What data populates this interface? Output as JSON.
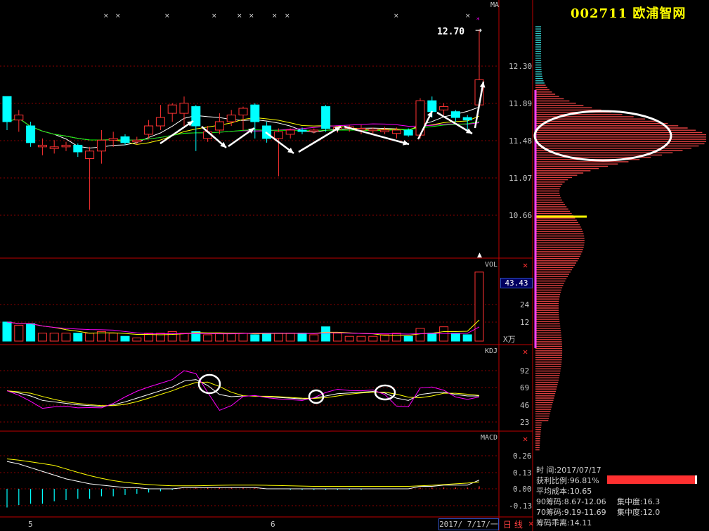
{
  "header": {
    "stock_title": "002711 欧浦智网",
    "ma_label": "MA",
    "high_label": "12.70"
  },
  "price_axis": [
    "12.30",
    "11.89",
    "11.48",
    "11.07",
    "10.66"
  ],
  "volume_panel": {
    "label": "VOL",
    "current": "43.43",
    "ticks": [
      "24",
      "12"
    ],
    "unit": "X万"
  },
  "kdj_panel": {
    "label": "KDJ",
    "ticks": [
      "92",
      "69",
      "46",
      "23"
    ]
  },
  "macd_panel": {
    "label": "MACD",
    "ticks": [
      "0.26",
      "0.13",
      "0.00",
      "-0.13"
    ]
  },
  "x_axis": [
    "5",
    "6"
  ],
  "footer": {
    "date": "2017/ 7/17/一",
    "period_tab": "日 线"
  },
  "chip_info": {
    "time": "时    间:2017/07/17",
    "profit_ratio": "获利比例:96.81%",
    "avg_cost": "平均成本:10.65",
    "chip90": "90筹码:8.67-12.06",
    "conc90": "集中度:16.3",
    "chip70": "70筹码:9.19-11.69",
    "conc70": "集中度:12.0",
    "chip_divergence": "筹码乖离:14.11"
  },
  "colors": {
    "up": "#ff3232",
    "down": "#00ffff",
    "grid": "#8a0000",
    "panel_border": "#c00000",
    "chip_red": "#e04040",
    "chip_cyan": "#30c8c8",
    "avg_cost_line": "#ffff00"
  },
  "chart_data": {
    "type": "candlestick",
    "note": "price window 10.2-12.9; last candle closes near 12.12",
    "candles": [
      {
        "o": 11.9,
        "c": 11.6,
        "h": 11.9,
        "l": 11.5
      },
      {
        "o": 11.62,
        "c": 11.68,
        "h": 11.74,
        "l": 11.48
      },
      {
        "o": 11.55,
        "c": 11.35,
        "h": 11.6,
        "l": 11.3
      },
      {
        "o": 11.3,
        "c": 11.32,
        "h": 11.4,
        "l": 11.2
      },
      {
        "o": 11.28,
        "c": 11.3,
        "h": 11.38,
        "l": 11.22
      },
      {
        "o": 11.3,
        "c": 11.32,
        "h": 11.36,
        "l": 11.25
      },
      {
        "o": 11.32,
        "c": 11.24,
        "h": 11.34,
        "l": 11.18
      },
      {
        "o": 11.16,
        "c": 11.25,
        "h": 11.3,
        "l": 10.55
      },
      {
        "o": 11.25,
        "c": 11.38,
        "h": 11.5,
        "l": 11.1
      },
      {
        "o": 11.38,
        "c": 11.4,
        "h": 11.48,
        "l": 11.3
      },
      {
        "o": 11.42,
        "c": 11.35,
        "h": 11.45,
        "l": 11.32
      },
      {
        "o": 11.36,
        "c": 11.38,
        "h": 11.42,
        "l": 11.33
      },
      {
        "o": 11.45,
        "c": 11.55,
        "h": 11.62,
        "l": 11.4
      },
      {
        "o": 11.55,
        "c": 11.65,
        "h": 11.8,
        "l": 11.5
      },
      {
        "o": 11.7,
        "c": 11.8,
        "h": 11.82,
        "l": 11.6
      },
      {
        "o": 11.7,
        "c": 11.82,
        "h": 11.9,
        "l": 11.55
      },
      {
        "o": 11.78,
        "c": 11.55,
        "h": 11.8,
        "l": 11.25
      },
      {
        "o": 11.4,
        "c": 11.48,
        "h": 11.55,
        "l": 11.36
      },
      {
        "o": 11.5,
        "c": 11.6,
        "h": 11.7,
        "l": 11.45
      },
      {
        "o": 11.6,
        "c": 11.68,
        "h": 11.74,
        "l": 11.55
      },
      {
        "o": 11.68,
        "c": 11.76,
        "h": 11.78,
        "l": 11.5
      },
      {
        "o": 11.8,
        "c": 11.6,
        "h": 11.82,
        "l": 11.4
      },
      {
        "o": 11.55,
        "c": 11.4,
        "h": 11.6,
        "l": 11.35
      },
      {
        "o": 11.4,
        "c": 11.48,
        "h": 11.52,
        "l": 10.95
      },
      {
        "o": 11.45,
        "c": 11.5,
        "h": 11.52,
        "l": 11.4
      },
      {
        "o": 11.5,
        "c": 11.49,
        "h": 11.53,
        "l": 11.45
      },
      {
        "o": 11.49,
        "c": 11.5,
        "h": 11.52,
        "l": 11.46
      },
      {
        "o": 11.78,
        "c": 11.52,
        "h": 11.8,
        "l": 11.48
      },
      {
        "o": 11.52,
        "c": 11.53,
        "h": 11.55,
        "l": 11.47
      },
      {
        "o": 11.52,
        "c": 11.54,
        "h": 11.56,
        "l": 11.48
      },
      {
        "o": 11.5,
        "c": 11.52,
        "h": 11.56,
        "l": 11.45
      },
      {
        "o": 11.5,
        "c": 11.51,
        "h": 11.53,
        "l": 11.46
      },
      {
        "o": 11.48,
        "c": 11.5,
        "h": 11.54,
        "l": 11.45
      },
      {
        "o": 11.46,
        "c": 11.5,
        "h": 11.53,
        "l": 11.4
      },
      {
        "o": 11.5,
        "c": 11.44,
        "h": 11.52,
        "l": 11.42
      },
      {
        "o": 11.44,
        "c": 11.85,
        "h": 11.88,
        "l": 11.4
      },
      {
        "o": 11.85,
        "c": 11.72,
        "h": 11.9,
        "l": 11.65
      },
      {
        "o": 11.74,
        "c": 11.78,
        "h": 11.82,
        "l": 11.68
      },
      {
        "o": 11.72,
        "c": 11.65,
        "h": 11.74,
        "l": 11.6
      },
      {
        "o": 11.65,
        "c": 11.62,
        "h": 11.68,
        "l": 11.5
      },
      {
        "o": 11.8,
        "c": 12.1,
        "h": 12.7,
        "l": 11.8
      }
    ],
    "volumes": [
      12,
      10,
      11,
      5,
      5,
      5,
      5,
      5,
      6,
      5,
      3,
      2,
      5,
      5,
      6,
      5,
      6,
      4,
      5,
      5,
      5,
      4,
      5,
      5,
      5,
      5,
      4,
      9,
      5,
      3,
      3,
      3,
      4,
      5,
      3,
      8,
      5,
      9,
      5,
      4,
      43.43
    ],
    "macd_hist": [
      -0.15,
      -0.13,
      -0.12,
      -0.12,
      -0.1,
      -0.09,
      -0.08,
      -0.08,
      -0.06,
      -0.06,
      -0.05,
      -0.04,
      -0.03,
      -0.02,
      -0.01,
      0.0,
      0.01,
      0.01,
      0.01,
      0.01,
      0.01,
      0.01,
      0.0,
      0.0,
      -0.01,
      -0.01,
      -0.01,
      -0.01,
      -0.01,
      -0.01,
      -0.01,
      0.0,
      0.0,
      0.0,
      0.0,
      0.01,
      0.01,
      0.01,
      0.01,
      0.01,
      0.02
    ]
  }
}
